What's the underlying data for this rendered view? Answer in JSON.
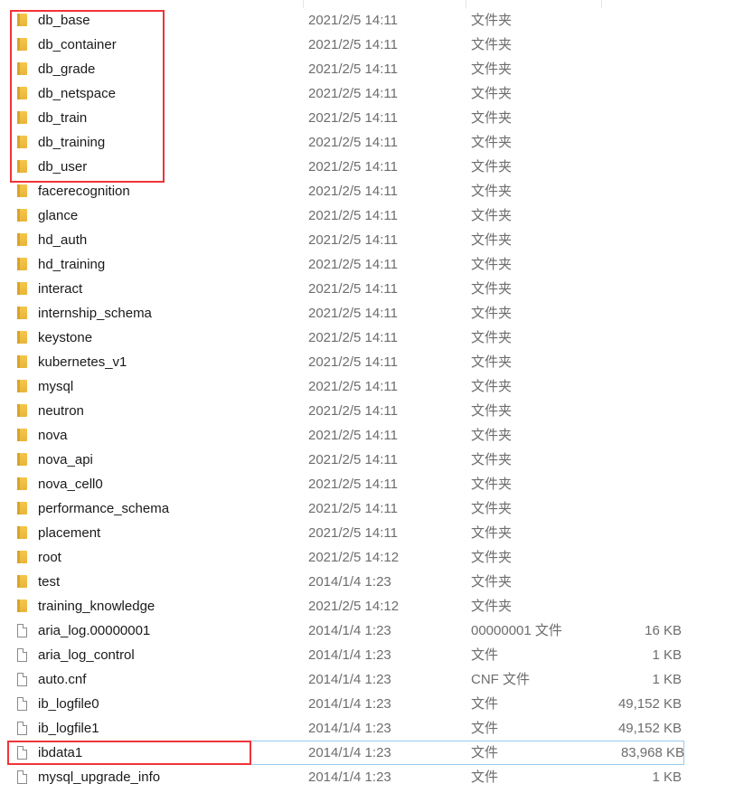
{
  "rows": [
    {
      "name": "db_base",
      "date": "2021/2/5 14:11",
      "type": "文件夹",
      "size": "",
      "kind": "folder"
    },
    {
      "name": "db_container",
      "date": "2021/2/5 14:11",
      "type": "文件夹",
      "size": "",
      "kind": "folder"
    },
    {
      "name": "db_grade",
      "date": "2021/2/5 14:11",
      "type": "文件夹",
      "size": "",
      "kind": "folder"
    },
    {
      "name": "db_netspace",
      "date": "2021/2/5 14:11",
      "type": "文件夹",
      "size": "",
      "kind": "folder"
    },
    {
      "name": "db_train",
      "date": "2021/2/5 14:11",
      "type": "文件夹",
      "size": "",
      "kind": "folder"
    },
    {
      "name": "db_training",
      "date": "2021/2/5 14:11",
      "type": "文件夹",
      "size": "",
      "kind": "folder"
    },
    {
      "name": "db_user",
      "date": "2021/2/5 14:11",
      "type": "文件夹",
      "size": "",
      "kind": "folder"
    },
    {
      "name": "facerecognition",
      "date": "2021/2/5 14:11",
      "type": "文件夹",
      "size": "",
      "kind": "folder"
    },
    {
      "name": "glance",
      "date": "2021/2/5 14:11",
      "type": "文件夹",
      "size": "",
      "kind": "folder"
    },
    {
      "name": "hd_auth",
      "date": "2021/2/5 14:11",
      "type": "文件夹",
      "size": "",
      "kind": "folder"
    },
    {
      "name": "hd_training",
      "date": "2021/2/5 14:11",
      "type": "文件夹",
      "size": "",
      "kind": "folder"
    },
    {
      "name": "interact",
      "date": "2021/2/5 14:11",
      "type": "文件夹",
      "size": "",
      "kind": "folder"
    },
    {
      "name": "internship_schema",
      "date": "2021/2/5 14:11",
      "type": "文件夹",
      "size": "",
      "kind": "folder"
    },
    {
      "name": "keystone",
      "date": "2021/2/5 14:11",
      "type": "文件夹",
      "size": "",
      "kind": "folder"
    },
    {
      "name": "kubernetes_v1",
      "date": "2021/2/5 14:11",
      "type": "文件夹",
      "size": "",
      "kind": "folder"
    },
    {
      "name": "mysql",
      "date": "2021/2/5 14:11",
      "type": "文件夹",
      "size": "",
      "kind": "folder"
    },
    {
      "name": "neutron",
      "date": "2021/2/5 14:11",
      "type": "文件夹",
      "size": "",
      "kind": "folder"
    },
    {
      "name": "nova",
      "date": "2021/2/5 14:11",
      "type": "文件夹",
      "size": "",
      "kind": "folder"
    },
    {
      "name": "nova_api",
      "date": "2021/2/5 14:11",
      "type": "文件夹",
      "size": "",
      "kind": "folder"
    },
    {
      "name": "nova_cell0",
      "date": "2021/2/5 14:11",
      "type": "文件夹",
      "size": "",
      "kind": "folder"
    },
    {
      "name": "performance_schema",
      "date": "2021/2/5 14:11",
      "type": "文件夹",
      "size": "",
      "kind": "folder"
    },
    {
      "name": "placement",
      "date": "2021/2/5 14:11",
      "type": "文件夹",
      "size": "",
      "kind": "folder"
    },
    {
      "name": "root",
      "date": "2021/2/5 14:12",
      "type": "文件夹",
      "size": "",
      "kind": "folder"
    },
    {
      "name": "test",
      "date": "2014/1/4 1:23",
      "type": "文件夹",
      "size": "",
      "kind": "folder"
    },
    {
      "name": "training_knowledge",
      "date": "2021/2/5 14:12",
      "type": "文件夹",
      "size": "",
      "kind": "folder"
    },
    {
      "name": "aria_log.00000001",
      "date": "2014/1/4 1:23",
      "type": "00000001 文件",
      "size": "16 KB",
      "kind": "file"
    },
    {
      "name": "aria_log_control",
      "date": "2014/1/4 1:23",
      "type": "文件",
      "size": "1 KB",
      "kind": "file"
    },
    {
      "name": "auto.cnf",
      "date": "2014/1/4 1:23",
      "type": "CNF 文件",
      "size": "1 KB",
      "kind": "file"
    },
    {
      "name": "ib_logfile0",
      "date": "2014/1/4 1:23",
      "type": "文件",
      "size": "49,152 KB",
      "kind": "file"
    },
    {
      "name": "ib_logfile1",
      "date": "2014/1/4 1:23",
      "type": "文件",
      "size": "49,152 KB",
      "kind": "file"
    },
    {
      "name": "ibdata1",
      "date": "2014/1/4 1:23",
      "type": "文件",
      "size": "83,968 KB",
      "kind": "file",
      "focused": true
    },
    {
      "name": "mysql_upgrade_info",
      "date": "2014/1/4 1:23",
      "type": "文件",
      "size": "1 KB",
      "kind": "file"
    }
  ],
  "colors": {
    "highlight": "#f0343a",
    "focus_outline": "#99c9ef",
    "folder": "#f5c64b"
  }
}
